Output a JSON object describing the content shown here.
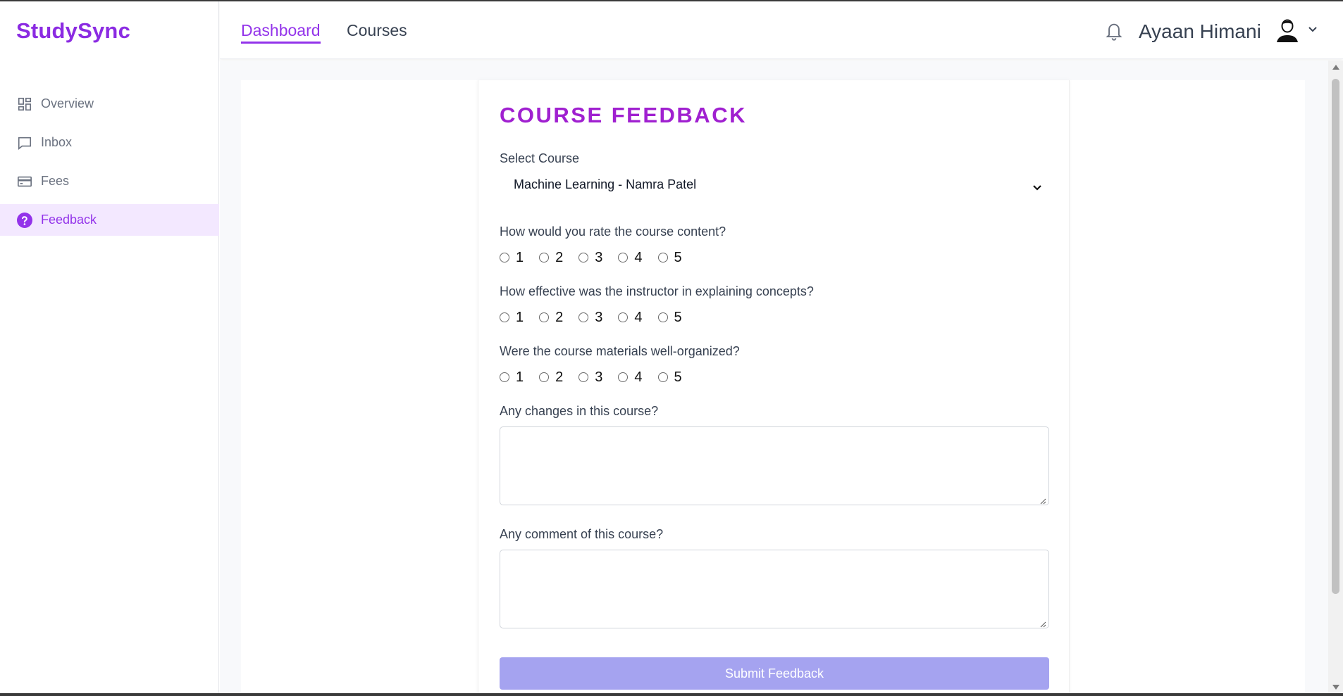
{
  "app": {
    "logo": "StudySync",
    "brand_color": "#8b2be2",
    "accent_color": "#9333ea"
  },
  "sidebar": {
    "items": [
      {
        "label": "Overview",
        "icon": "grid-icon",
        "active": false
      },
      {
        "label": "Inbox",
        "icon": "message-icon",
        "active": false
      },
      {
        "label": "Fees",
        "icon": "credit-card-icon",
        "active": false
      },
      {
        "label": "Feedback",
        "icon": "help-circle-icon",
        "active": true
      }
    ]
  },
  "header": {
    "tabs": [
      {
        "label": "Dashboard",
        "active": true
      },
      {
        "label": "Courses",
        "active": false
      }
    ],
    "user_name": "Ayaan Himani",
    "icons": [
      "bell-icon",
      "avatar",
      "chevron-down-icon"
    ]
  },
  "form": {
    "title": "COURSE FEEDBACK",
    "select_label": "Select Course",
    "selected_course": "Machine Learning - Namra Patel",
    "questions": [
      {
        "text": "How would you rate the course content?",
        "options": [
          "1",
          "2",
          "3",
          "4",
          "5"
        ],
        "selected": null
      },
      {
        "text": "How effective was the instructor in explaining concepts?",
        "options": [
          "1",
          "2",
          "3",
          "4",
          "5"
        ],
        "selected": null
      },
      {
        "text": "Were the course materials well-organized?",
        "options": [
          "1",
          "2",
          "3",
          "4",
          "5"
        ],
        "selected": null
      }
    ],
    "changes_label": "Any changes in this course?",
    "changes_value": "",
    "comment_label": "Any comment of this course?",
    "comment_value": "",
    "submit_label": "Submit Feedback",
    "submit_color": "#a5a3f0"
  }
}
